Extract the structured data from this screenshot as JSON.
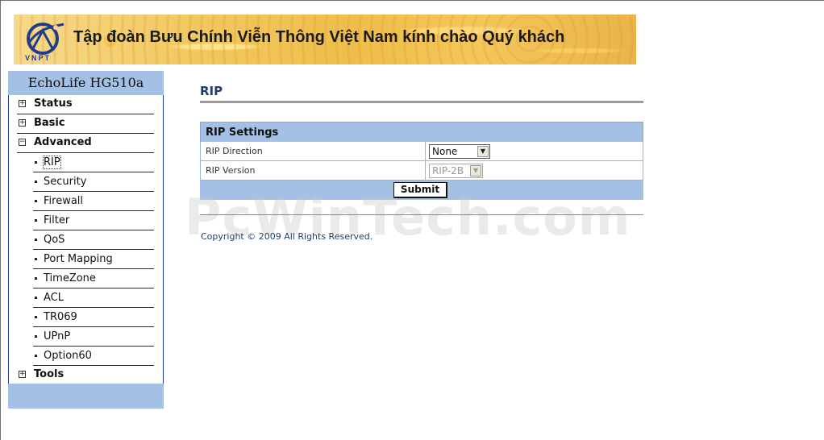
{
  "banner": {
    "logo_text": "VNPT",
    "title": "Tập đoàn Bưu Chính Viễn Thông Việt Nam kính chào Quý khách"
  },
  "sidebar": {
    "device_title": "EchoLife HG510a",
    "items": [
      {
        "label": "Status",
        "toggle": "+"
      },
      {
        "label": "Basic",
        "toggle": "+"
      },
      {
        "label": "Advanced",
        "toggle": "−"
      },
      {
        "label": "Tools",
        "toggle": "+"
      }
    ],
    "advanced_items": [
      "RIP",
      "Security",
      "Firewall",
      "Filter",
      "QoS",
      "Port Mapping",
      "TimeZone",
      "ACL",
      "TR069",
      "UPnP",
      "Option60"
    ],
    "active_item": "RIP"
  },
  "main": {
    "page_title": "RIP",
    "panel_title": "RIP Settings",
    "rows": [
      {
        "label": "RIP Direction",
        "value": "None",
        "disabled": false
      },
      {
        "label": "RIP Version",
        "value": "RIP-2B",
        "disabled": true
      }
    ],
    "submit_label": "Submit",
    "copyright": "Copyright © 2009 All Rights Reserved."
  },
  "watermark": "PcWinTech.com",
  "colors": {
    "accent_blue": "#a4c0e4",
    "title_blue": "#1f3d70",
    "banner_gold": "#f1c85f"
  }
}
